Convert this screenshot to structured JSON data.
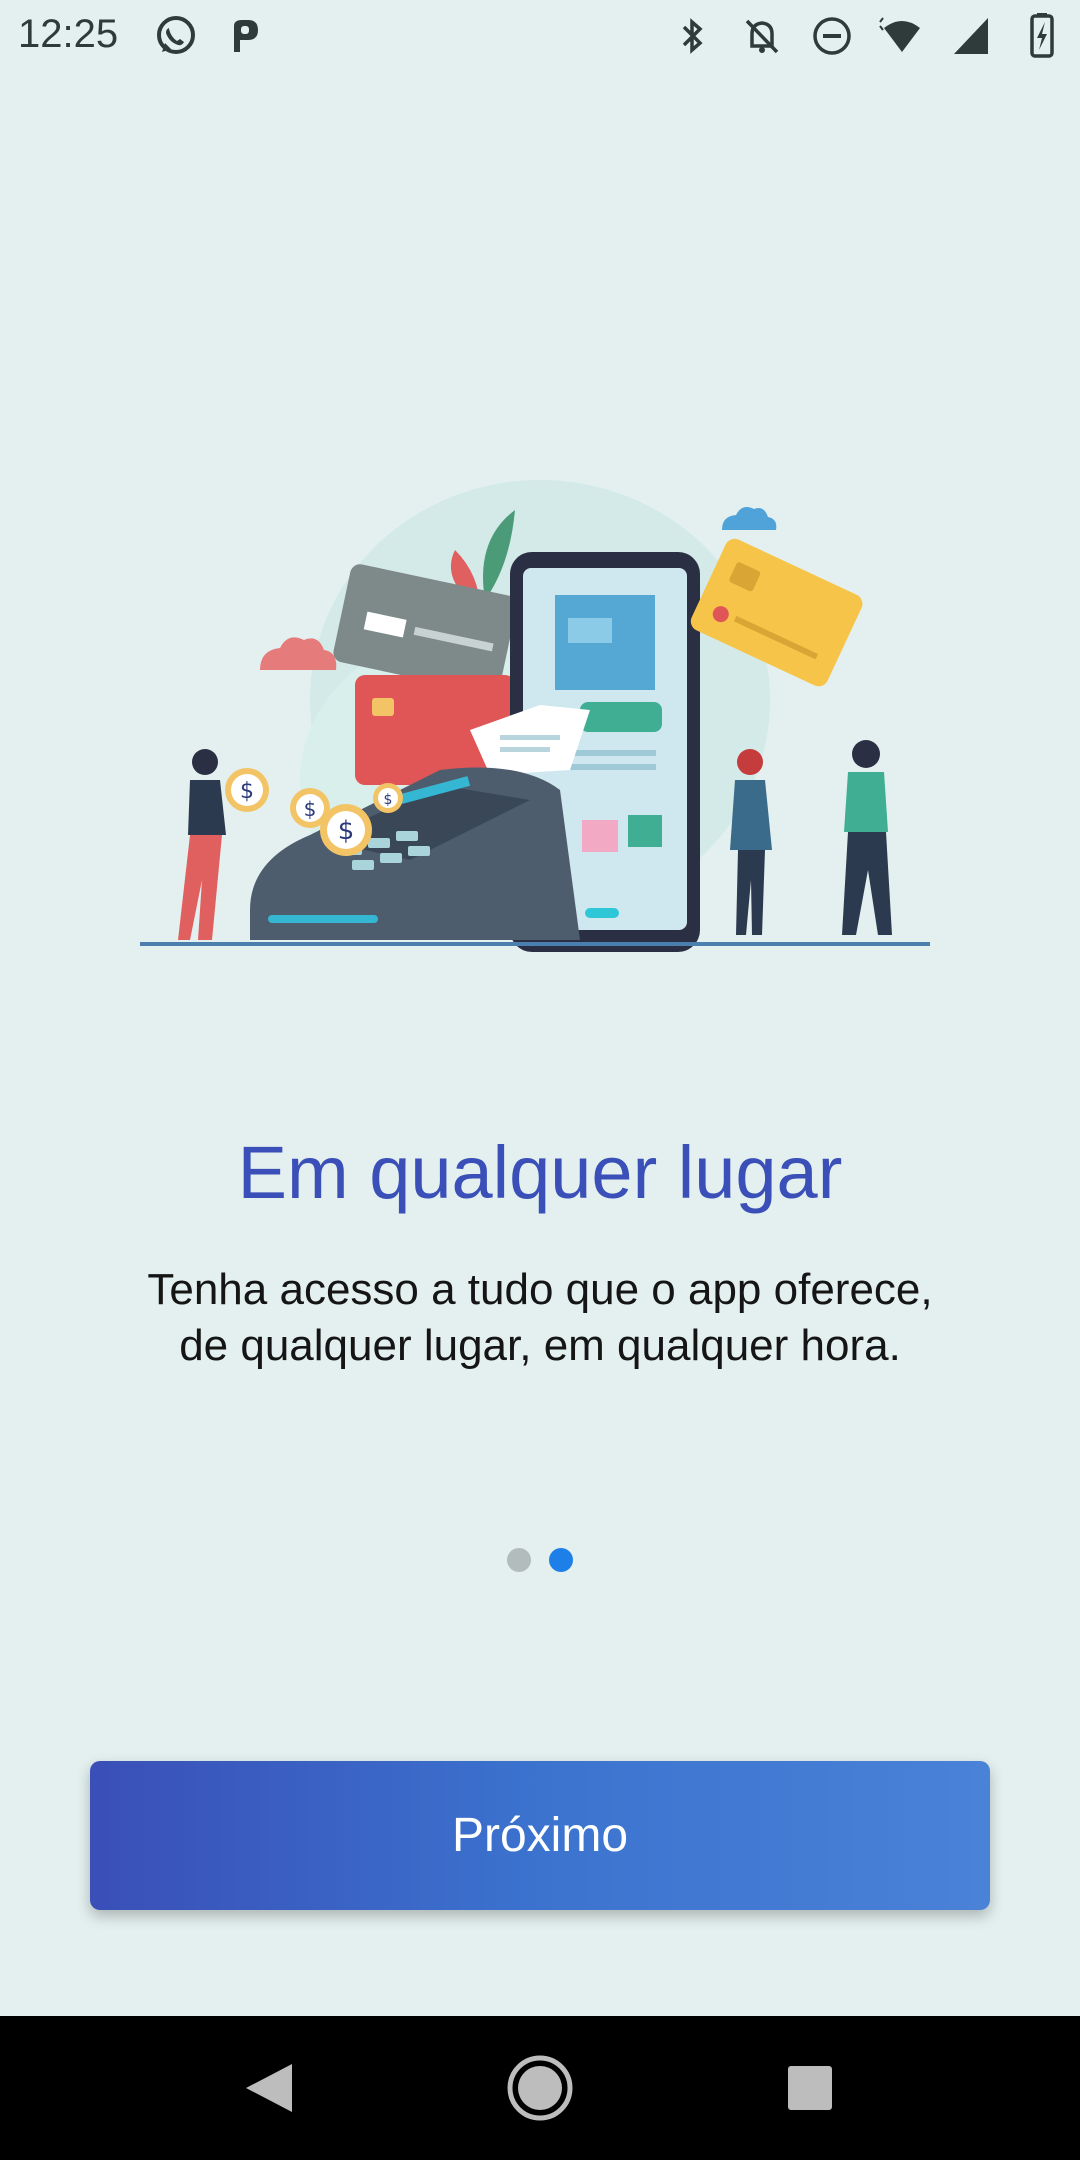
{
  "status_bar": {
    "time": "12:25",
    "left_icons": [
      "whatsapp-icon",
      "parking-icon"
    ],
    "right_icons": [
      "bluetooth-icon",
      "notifications-off-icon",
      "do-not-disturb-icon",
      "wifi-icon",
      "cell-signal-icon",
      "battery-charging-icon"
    ]
  },
  "onboarding": {
    "title": "Em qualquer lugar",
    "subtitle_line1": "Tenha acesso a tudo que o app oferece,",
    "subtitle_line2": "de qualquer lugar, em qualquer hora.",
    "page_count": 2,
    "current_page": 2
  },
  "next_button": {
    "label": "Próximo"
  },
  "nav_bar": {
    "buttons": [
      "back-icon",
      "home-icon",
      "recents-icon"
    ]
  },
  "colors": {
    "background": "#e3f0ef",
    "title": "#3a4fb7",
    "button_gradient_start": "#3a4fb8",
    "button_gradient_end": "#4a82d8",
    "dot_active": "#1f7fe8",
    "dot_inactive": "#b3bcbc"
  }
}
